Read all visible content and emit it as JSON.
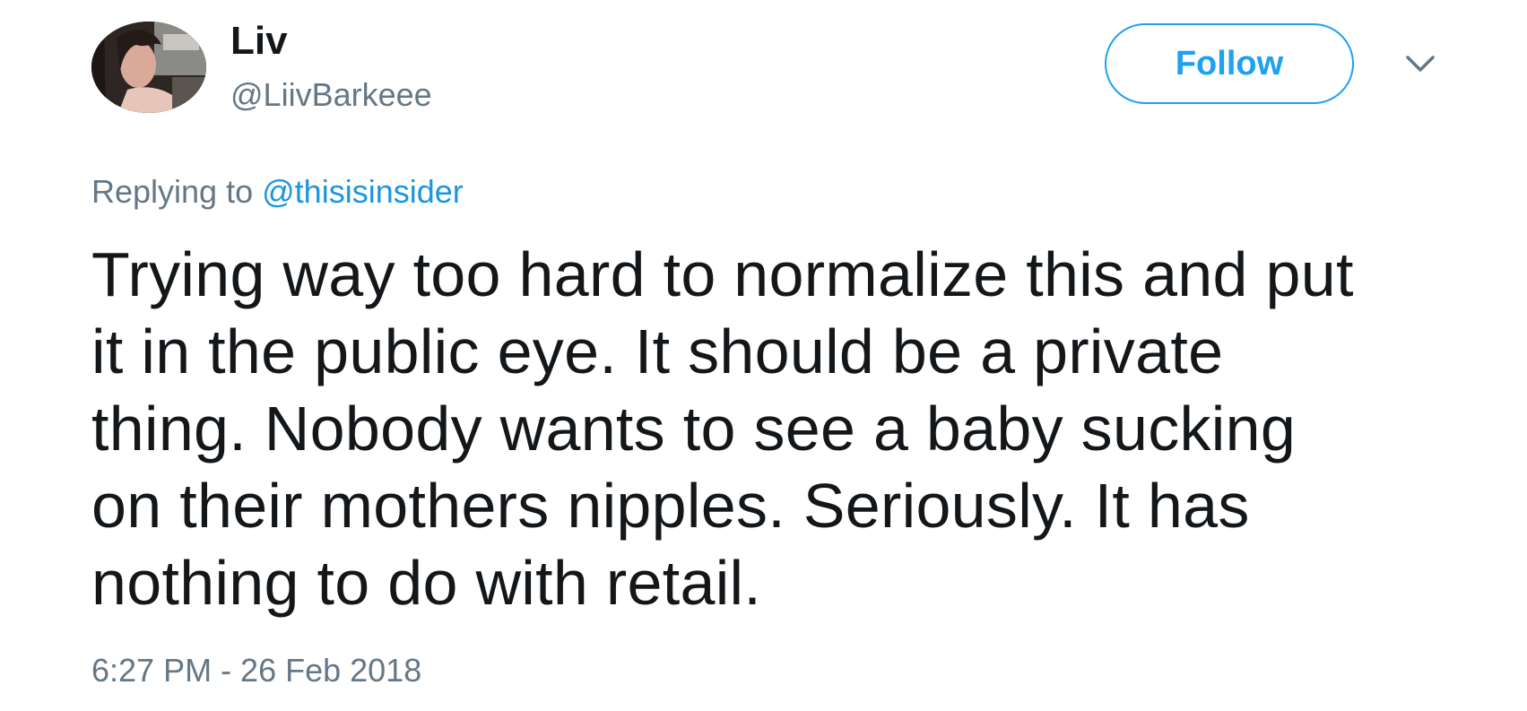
{
  "author": {
    "display_name": "Liv",
    "handle": "@LiivBarkeee",
    "avatar_icon": "user-avatar-photo"
  },
  "actions": {
    "follow_label": "Follow",
    "menu_icon": "chevron-down-icon"
  },
  "reply": {
    "prefix": "Replying to",
    "mention": "@thisisinsider"
  },
  "tweet": {
    "text": "Trying way too hard to normalize this and put\nit in the public eye. It should be a private\nthing. Nobody wants to see a baby sucking\non their mothers nipples. Seriously. It has\nnothing to do with retail.",
    "timestamp": "6:27 PM - 26 Feb 2018"
  },
  "colors": {
    "text": "#14171a",
    "secondary": "#657786",
    "accent": "#1da1f2",
    "mention": "#1b95e0",
    "background": "#ffffff"
  }
}
